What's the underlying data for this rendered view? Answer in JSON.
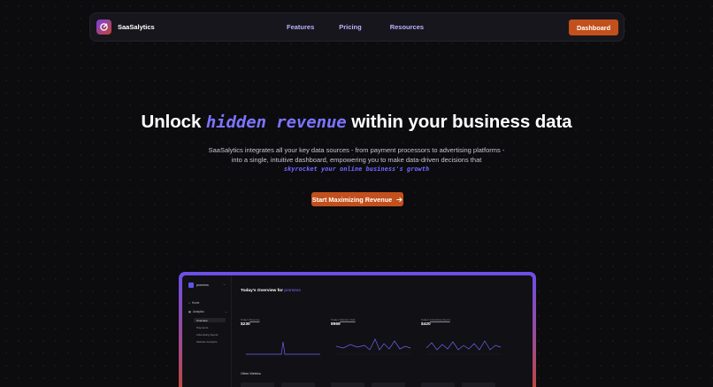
{
  "nav": {
    "brand": "SaaSalytics",
    "links": [
      "Features",
      "Pricing",
      "Resources"
    ],
    "dashboard_label": "Dashboard"
  },
  "hero": {
    "title_pre": "Unlock",
    "title_highlight": "hidden revenue",
    "title_post": "within your business data",
    "description": "SaaSalytics integrates all your key data sources - from payment processors to advertising platforms - into a single, intuitive dashboard, empowering you to make data-driven decisions that",
    "description_highlight": "skyrocket your online business's growth",
    "cta_label": "Start Maximizing Revenue",
    "cta_icon": "arrow-right-icon"
  },
  "preview": {
    "org_name": "promexs",
    "sidebar": {
      "home": "Home",
      "analytics": "Analytics",
      "sub_items": [
        "Overview",
        "Payments",
        "Advertising Spend",
        "Website Analytics"
      ]
    },
    "title_pre": "Today's Overview for",
    "title_highlight": "promexs",
    "cards": [
      {
        "label_pre": "Today's",
        "label_link": "Revenue",
        "value": "$230"
      },
      {
        "label_pre": "Today's",
        "label_link": "Website Visits",
        "value": "8969"
      },
      {
        "label_pre": "Today's",
        "label_link": "Advertising Spend",
        "value": "$420"
      }
    ],
    "other_metrics_label": "Other Metrics",
    "colors": {
      "accent": "#7c74ff",
      "orange": "#c2501c"
    }
  }
}
